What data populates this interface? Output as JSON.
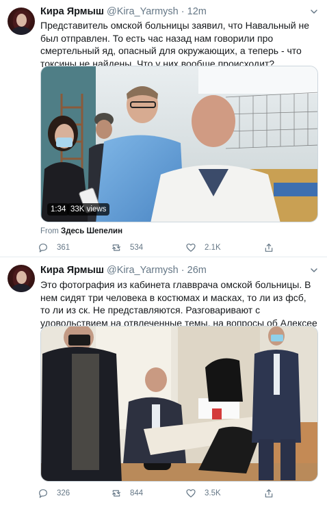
{
  "tweets": [
    {
      "author": "Кира Ярмыш",
      "handle": "@Kira_Yarmysh",
      "separator": "·",
      "time": "12m",
      "text": "Представитель омской больницы заявил, что Навальный не был отправлен. То есть час назад нам говорили про смертельный яд, опасный для окружающих, а теперь - что токсины не найдены. Что у них вообще происходит?",
      "video": {
        "duration": "1:34",
        "views": "33K views"
      },
      "source": {
        "prefix": "From",
        "name": "Здесь Шепелин"
      },
      "counts": {
        "replies": "361",
        "retweets": "534",
        "likes": "2.1K"
      }
    },
    {
      "author": "Кира Ярмыш",
      "handle": "@Kira_Yarmysh",
      "separator": "·",
      "time": "26m",
      "text": "Это фотография из кабинета главврача омской больницы. В нем сидят три человека в костюмах и масках, то ли из фсб, то ли из ск. Не представляются. Разговаривают с удовольствием на отвлеченные темы, на вопросы об Алексее не отвечают. Врача в кабинете нет",
      "counts": {
        "replies": "326",
        "retweets": "844",
        "likes": "3.5K"
      }
    }
  ],
  "icons": {
    "reply": "reply-icon",
    "retweet": "retweet-icon",
    "like": "heart-icon",
    "share": "share-icon",
    "more": "chevron-down-icon"
  },
  "colors": {
    "text": "#14171a",
    "secondary": "#657786",
    "border": "#e6ecf0"
  }
}
